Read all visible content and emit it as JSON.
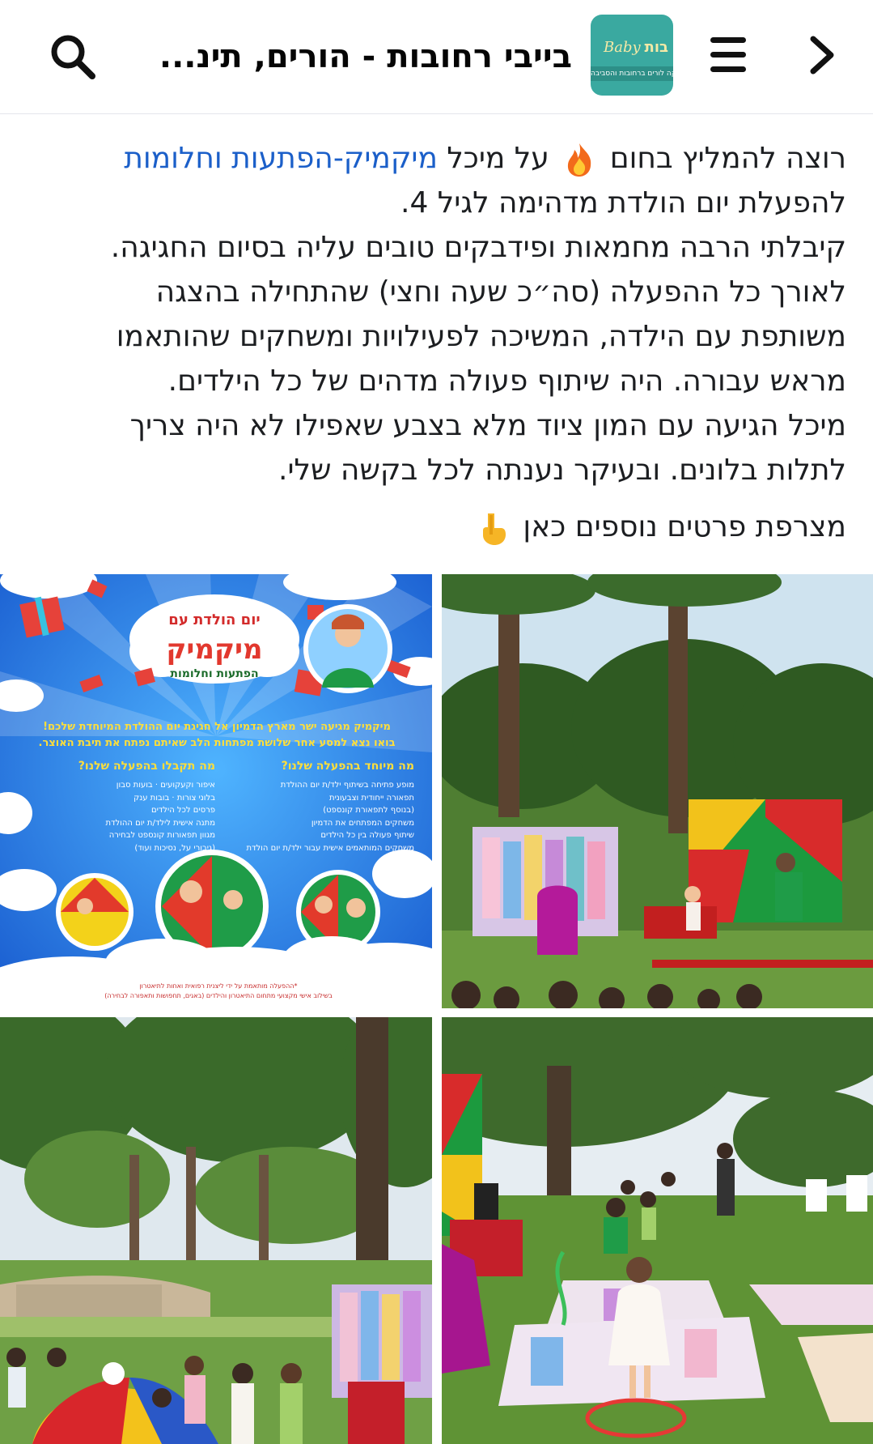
{
  "header": {
    "title": "בייבי רחובות - הורים, תינ...",
    "logo": {
      "word": "Baby",
      "heb": "בות",
      "strip": "קה לורים ברחובות והסביבה"
    },
    "icons": {
      "back": "chevron-right-icon",
      "menu": "hamburger-menu-icon",
      "search": "search-icon"
    }
  },
  "post": {
    "line1_pre": "רוצה להמליץ בחום",
    "line1_mid": "על מיכל",
    "mention": "מיקמיק-הפתעות וחלומות",
    "body_lines": [
      "להפעלת יום הולדת מדהימה לגיל 4.",
      "קיבלתי הרבה מחמאות ופידבקים טובים עליה בסיום החגיגה.",
      "לאורך כל ההפעלה (סה״כ שעה וחצי) שהתחילה בהצגה",
      "משותפת עם הילדה, המשיכה לפעילויות ומשחקים שהותאמו",
      "מראש עבורה. היה שיתוף פעולה מדהים של כל הילדים.",
      "מיכל הגיעה עם המון ציוד מלא בצבע שאפילו לא היה צריך",
      "לתלות בלונים. ובעיקר נענתה לכל בקשה שלי."
    ],
    "extra": "מצרפת פרטים נוספים כאן"
  },
  "flyer": {
    "title": "יום הולדת עם",
    "brand": "מיקמיק",
    "brand_sub": "הפתעות וחלומות",
    "banner_1": "מיקמיק מגיעה ישר מארץ הדמיון אל חגיגת יום ההולדת המיוחדת שלכם!",
    "banner_2": "בואו נצא למסע אחר שלושת מפתחות הלב שאיתם נפתח את תיבת האוצר.",
    "col_right_head": "מה מיוחד בהפעלה שלנו?",
    "col_right_items": [
      "מופע פתיחה בשיתוף ילד/ת יום ההולדת",
      "תפאורה ייחודית וצבעונית",
      "(בנוסף לתפאורת קונספט)",
      "משחקים המפתחים את הדמיון",
      "שיתוף פעולה בין כל הילדים",
      "משחקים המותאמים אישית עבור ילד/ת יום הולדת"
    ],
    "col_left_head": "מה תקבלו בהפעלה שלנו?",
    "col_left_items": [
      "איפור וקעקועים · בועות סבון",
      "בלוני צורות · בובות ענק",
      "פרסים לכל הילדים",
      "מתנה אישית לילד/ת יום ההולדת",
      "מגוון תפאורות קונספט לבחירה",
      "(גיבורי על, נסיכות ועוד)"
    ],
    "footer_1": "*ההפעלה מותאמת על ידי ליצנית רפואית ואחות לתיאטרון",
    "footer_2": "בשילוב אישי מקצועי מתחום התיאטרון והילדים (באגים, תחפושות ותאפורה לבחירה)"
  },
  "photos": {
    "stage": "stage-performance-photo",
    "park": "park-children-photo",
    "kids": "kids-game-photo"
  },
  "colors": {
    "mention": "#1b5fc9",
    "logo_bg": "#3aa9a0",
    "text": "#1c1e21"
  }
}
